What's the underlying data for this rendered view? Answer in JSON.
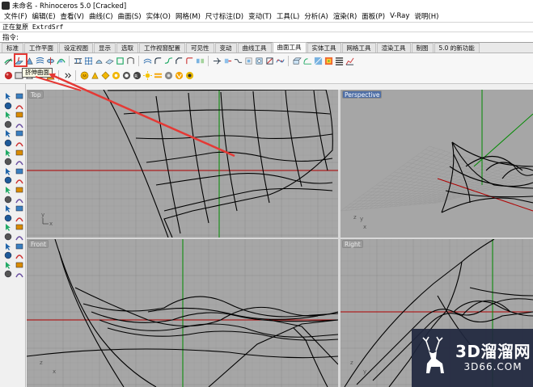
{
  "window": {
    "title": "未命名 - Rhinoceros 5.0 [Cracked]"
  },
  "menu": [
    "文件(F)",
    "编辑(E)",
    "查看(V)",
    "曲线(C)",
    "曲面(S)",
    "实体(O)",
    "网格(M)",
    "尺寸标注(D)",
    "变动(T)",
    "工具(L)",
    "分析(A)",
    "渲染(R)",
    "面板(P)",
    "V-Ray",
    "说明(H)"
  ],
  "command": {
    "history": "正在复原 ExtrdSrf",
    "prompt": "指令:",
    "value": ""
  },
  "tabs": [
    "标准",
    "工作平面",
    "设定视图",
    "显示",
    "选取",
    "工作视窗配置",
    "可见性",
    "变动",
    "曲线工具",
    "曲面工具",
    "实体工具",
    "网格工具",
    "渲染工具",
    "制图",
    "5.0 的新功能"
  ],
  "active_tab": "曲面工具",
  "tooltip": "挤伸曲面",
  "toolbar_row1_icons": [
    "extrude-surface-icon",
    "extrude-to-point-icon",
    "loft-icon",
    "rail-revolve-icon",
    "sweep1-icon",
    "sweep2-icon",
    "network-srf-icon",
    "patch-icon",
    "plane-icon",
    "edge-srf-icon",
    "rib-icon",
    "offset-srf-icon",
    "fillet-srf-icon",
    "blend-srf-icon",
    "chamfer-srf-icon",
    "variable-fillet-icon",
    "match-srf-icon",
    "merge-srf-icon",
    "extend-srf-icon",
    "connect-srf-icon",
    "shrink-srf-icon",
    "untrim-icon",
    "split-icon",
    "rebuild-icon",
    "ribbon-icon",
    "unroll-icon",
    "analysis-icon",
    "curvature-icon",
    "zebra-icon",
    "draft-icon"
  ],
  "toolbar_row2_icons": [
    "sphere-red-icon",
    "rect-srf-icon",
    "corner-pts-icon",
    "torus-icon",
    "cone-icon",
    "expand-icon",
    "material-icon",
    "environment-icon",
    "texture-icon",
    "decal-icon",
    "render-icon",
    "light-icon",
    "sun-icon",
    "vray-icon",
    "vray-options-icon",
    "vray-render-icon"
  ],
  "viewports": {
    "top": {
      "label": "Top",
      "axes": [
        "y",
        "x"
      ]
    },
    "perspective": {
      "label": "Perspective",
      "axes": [
        "z",
        "y",
        "x"
      ]
    },
    "front": {
      "label": "Front",
      "axes": [
        "z",
        "x"
      ]
    },
    "right": {
      "label": "Right",
      "axes": [
        "z",
        "y"
      ]
    }
  },
  "watermark": {
    "brand": "3D溜溜网",
    "site": "3D66.COM"
  },
  "colors": {
    "highlight": "#e53935",
    "viewport_bg": "#a6a6a6",
    "grid": "#9a9a9a",
    "x_axis": "#b00000",
    "y_axis": "#009000",
    "active_viewport": "#4f6fa6"
  }
}
